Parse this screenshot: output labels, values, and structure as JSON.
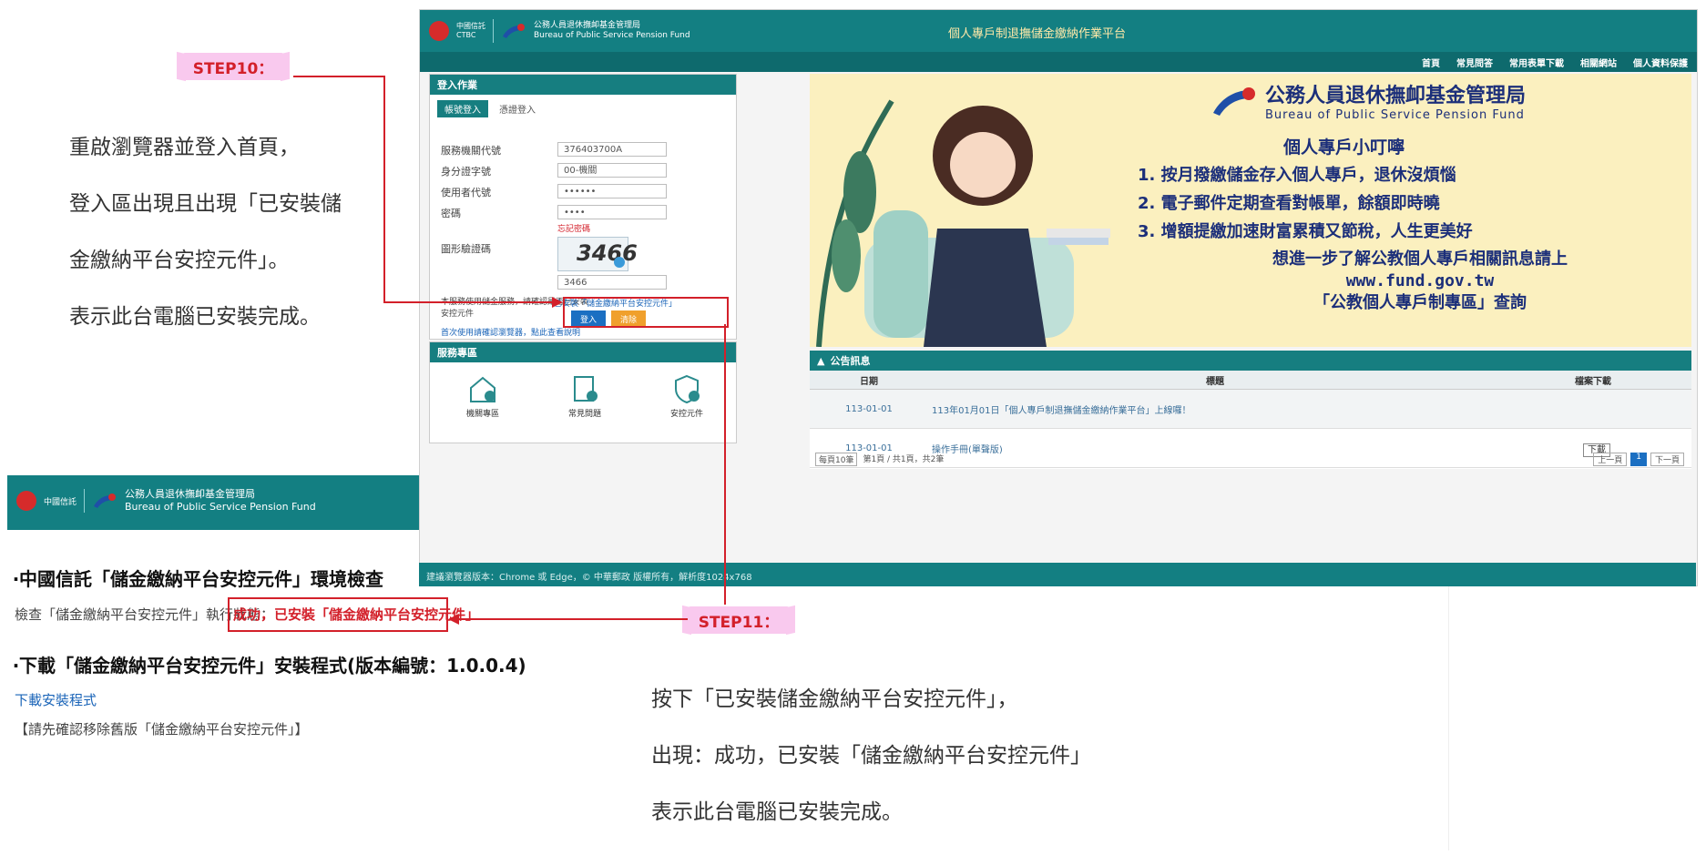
{
  "colors": {
    "teal": "#137f82",
    "red": "#d3202a",
    "pink": "#f9c9ee",
    "link": "#1a64b8"
  },
  "step10": {
    "label": "STEP10：",
    "lines": [
      "重啟瀏覽器並登入首頁，",
      "登入區出現且出現「已安裝儲",
      "金繳納平台安控元件」。",
      "表示此台電腦已安裝完成。"
    ]
  },
  "step11": {
    "label": "STEP11：",
    "lines": [
      "按下「已安裝儲金繳納平台安控元件」，",
      "出現：成功，已安裝「儲金繳納平台安控元件」",
      "表示此台電腦已安裝完成。"
    ]
  },
  "portal": {
    "header": {
      "org_cn": "公務人員退休撫卹基金管理局",
      "org_en": "Bureau of Public Service Pension Fund",
      "title": "個人專戶制退撫儲金繳納作業平台"
    },
    "nav": [
      "首頁",
      "常見問答",
      "常用表單下載",
      "相關網站",
      "個人資料保護"
    ],
    "login": {
      "panel_title": "登入作業",
      "tabs": [
        "帳號登入",
        "憑證登入"
      ],
      "fields": [
        {
          "label": "服務機關代號",
          "value": "376403700A"
        },
        {
          "label": "身分證字號",
          "value": "00-機關"
        },
        {
          "label": "使用者代號",
          "value": "••••••"
        },
        {
          "label": "密碼",
          "value": "••••"
        }
      ],
      "forgot": "忘記密碼",
      "captcha_label": "圖形驗證碼",
      "captcha_code": "3466",
      "captcha_input": "3466",
      "installed_label": "已安裝「儲金繳納平台安控元件」",
      "hint_text": "本服務使用儲金服務，請確認是否已安裝",
      "hint_text2": "安控元件",
      "notice_link": "首次使用請確認瀏覽器，點此查看說明",
      "login_button": "登入",
      "clear_button": "清除"
    },
    "services": {
      "title": "服務專區",
      "items": [
        "機關專區",
        "常見問題",
        "安控元件"
      ]
    },
    "banner": {
      "org_cn": "公務人員退休撫卹基金管理局",
      "org_en": "Bureau of Public Service Pension Fund",
      "heading": "個人專戶小叮嚀",
      "tips": [
        "1. 按月撥繳儲金存入個人專戶，退休沒煩惱",
        "2. 電子郵件定期查看對帳單，餘額即時曉",
        "3. 增額提繳加速財富累積又節稅，人生更美好"
      ],
      "more1": "想進一步了解公教個人專戶相關訊息請上",
      "url": "www.fund.gov.tw",
      "more2": "「公教個人專戶制專區」查詢"
    },
    "announcements": {
      "title": "公告訊息",
      "columns": [
        "日期",
        "標題",
        "檔案下載"
      ],
      "rows": [
        {
          "date": "113-01-01",
          "title": "113年01月01日「個人專戶制退撫儲金繳納作業平台」上線囉！",
          "download": ""
        },
        {
          "date": "113-01-01",
          "title": "操作手冊(單聲版)",
          "download": "下載"
        }
      ],
      "pager_select": "每頁10筆",
      "pager_info": "第1頁 / 共1頁，共2筆",
      "pager_prev": "上一頁",
      "pager_page": "1",
      "pager_next": "下一頁"
    },
    "footer": "建議瀏覽器版本：Chrome 或 Edge，© 中華郵政 版權所有，解析度1024x768"
  },
  "mini": {
    "org_cn": "公務人員退休撫卹基金管理局",
    "org_en": "Bureau of Public Service Pension Fund",
    "bank": "中國信託",
    "heading1": "‧中國信託「儲金繳納平台安控元件」環境檢查",
    "check_text": "檢查「儲金繳納平台安控元件」執行狀態：",
    "result": "成功，已安裝「儲金繳納平台安控元件」",
    "heading2": "‧下載「儲金繳納平台安控元件」安裝程式(版本編號：1.0.0.4)",
    "download_link": "下載安裝程式",
    "remove_note": "【請先確認移除舊版「儲金繳納平台安控元件」】"
  }
}
